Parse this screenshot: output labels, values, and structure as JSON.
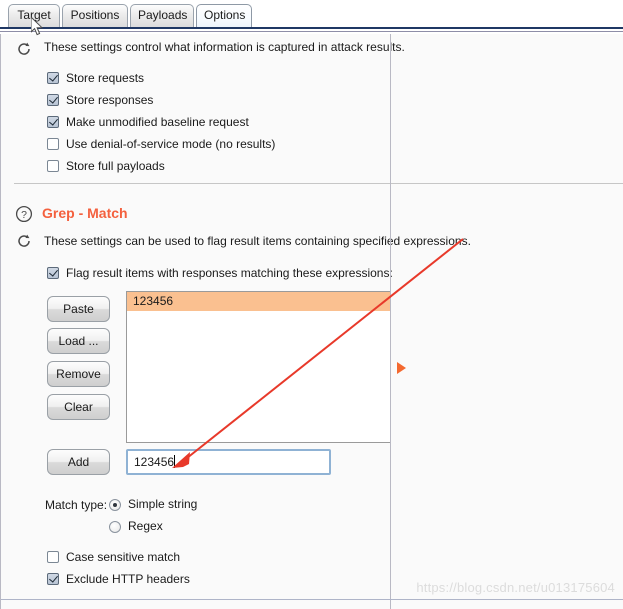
{
  "window": {
    "tabs": [
      {
        "label": "Target",
        "active": false
      },
      {
        "label": "Positions",
        "active": false
      },
      {
        "label": "Payloads",
        "active": false
      },
      {
        "label": "Options",
        "active": true
      }
    ]
  },
  "attack_results": {
    "description": "These settings control what information is captured in attack results.",
    "options": [
      {
        "label": "Store requests",
        "checked": true
      },
      {
        "label": "Store responses",
        "checked": true
      },
      {
        "label": "Make unmodified baseline request",
        "checked": true
      },
      {
        "label": "Use denial-of-service mode (no results)",
        "checked": false
      },
      {
        "label": "Store full payloads",
        "checked": false
      }
    ]
  },
  "grep_match": {
    "title_main": "Grep",
    "title_sep": " - ",
    "title_sub": "Match",
    "description": "These settings can be used to flag result items containing specified expressions.",
    "flag_checkbox": {
      "label": "Flag result items with responses matching these expressions:",
      "checked": true
    },
    "buttons": [
      {
        "label": "Paste"
      },
      {
        "label": "Load ..."
      },
      {
        "label": "Remove"
      },
      {
        "label": "Clear"
      }
    ],
    "expressions": [
      {
        "value": "123456",
        "selected": true
      }
    ],
    "add_button": {
      "label": "Add"
    },
    "add_input": {
      "value": "123456",
      "placeholder": ""
    },
    "match_type": {
      "label": "Match type:",
      "options": [
        {
          "label": "Simple string",
          "selected": true
        },
        {
          "label": "Regex",
          "selected": false
        }
      ]
    },
    "extra_options": [
      {
        "label": "Case sensitive match",
        "checked": false
      },
      {
        "label": "Exclude HTTP headers",
        "checked": true
      }
    ]
  },
  "watermark": {
    "text": "https://blog.csdn.net/u013175604"
  },
  "colors": {
    "accent_orange": "#f4603e",
    "selection_peach": "#fac090",
    "annotation_red": "#e8392a",
    "tab_border": "#9aa3ad",
    "panel_bg": "#fafafa"
  }
}
